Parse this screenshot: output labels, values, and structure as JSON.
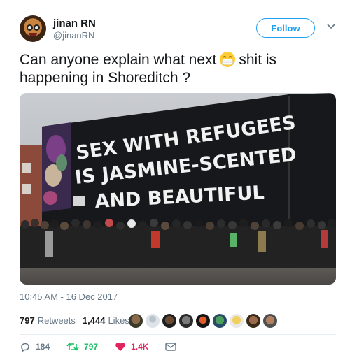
{
  "author": {
    "name": "jinan RN",
    "handle": "@jinanRN"
  },
  "follow_label": "Follow",
  "tweet": {
    "text_before": "Can anyone explain what next",
    "text_after": "shit is happening in Shoreditch ?",
    "emoji": "face-with-medical-mask"
  },
  "photo": {
    "mural_lines": [
      "SEX WITH REFUGEES",
      "IS JASMINE-SCENTED",
      "AND BEAUTIFUL"
    ]
  },
  "timestamp": "10:45 AM - 16 Dec 2017",
  "stats": {
    "retweets_count": "797",
    "retweets_label": "Retweets",
    "likes_count": "1,444",
    "likes_label": "Likes"
  },
  "actions": {
    "replies": "184",
    "retweets": "797",
    "likes": "1.4K"
  },
  "colors": {
    "accent": "#1da1f2",
    "retweet": "#17bf63",
    "like": "#e0245e",
    "muted": "#657786"
  }
}
